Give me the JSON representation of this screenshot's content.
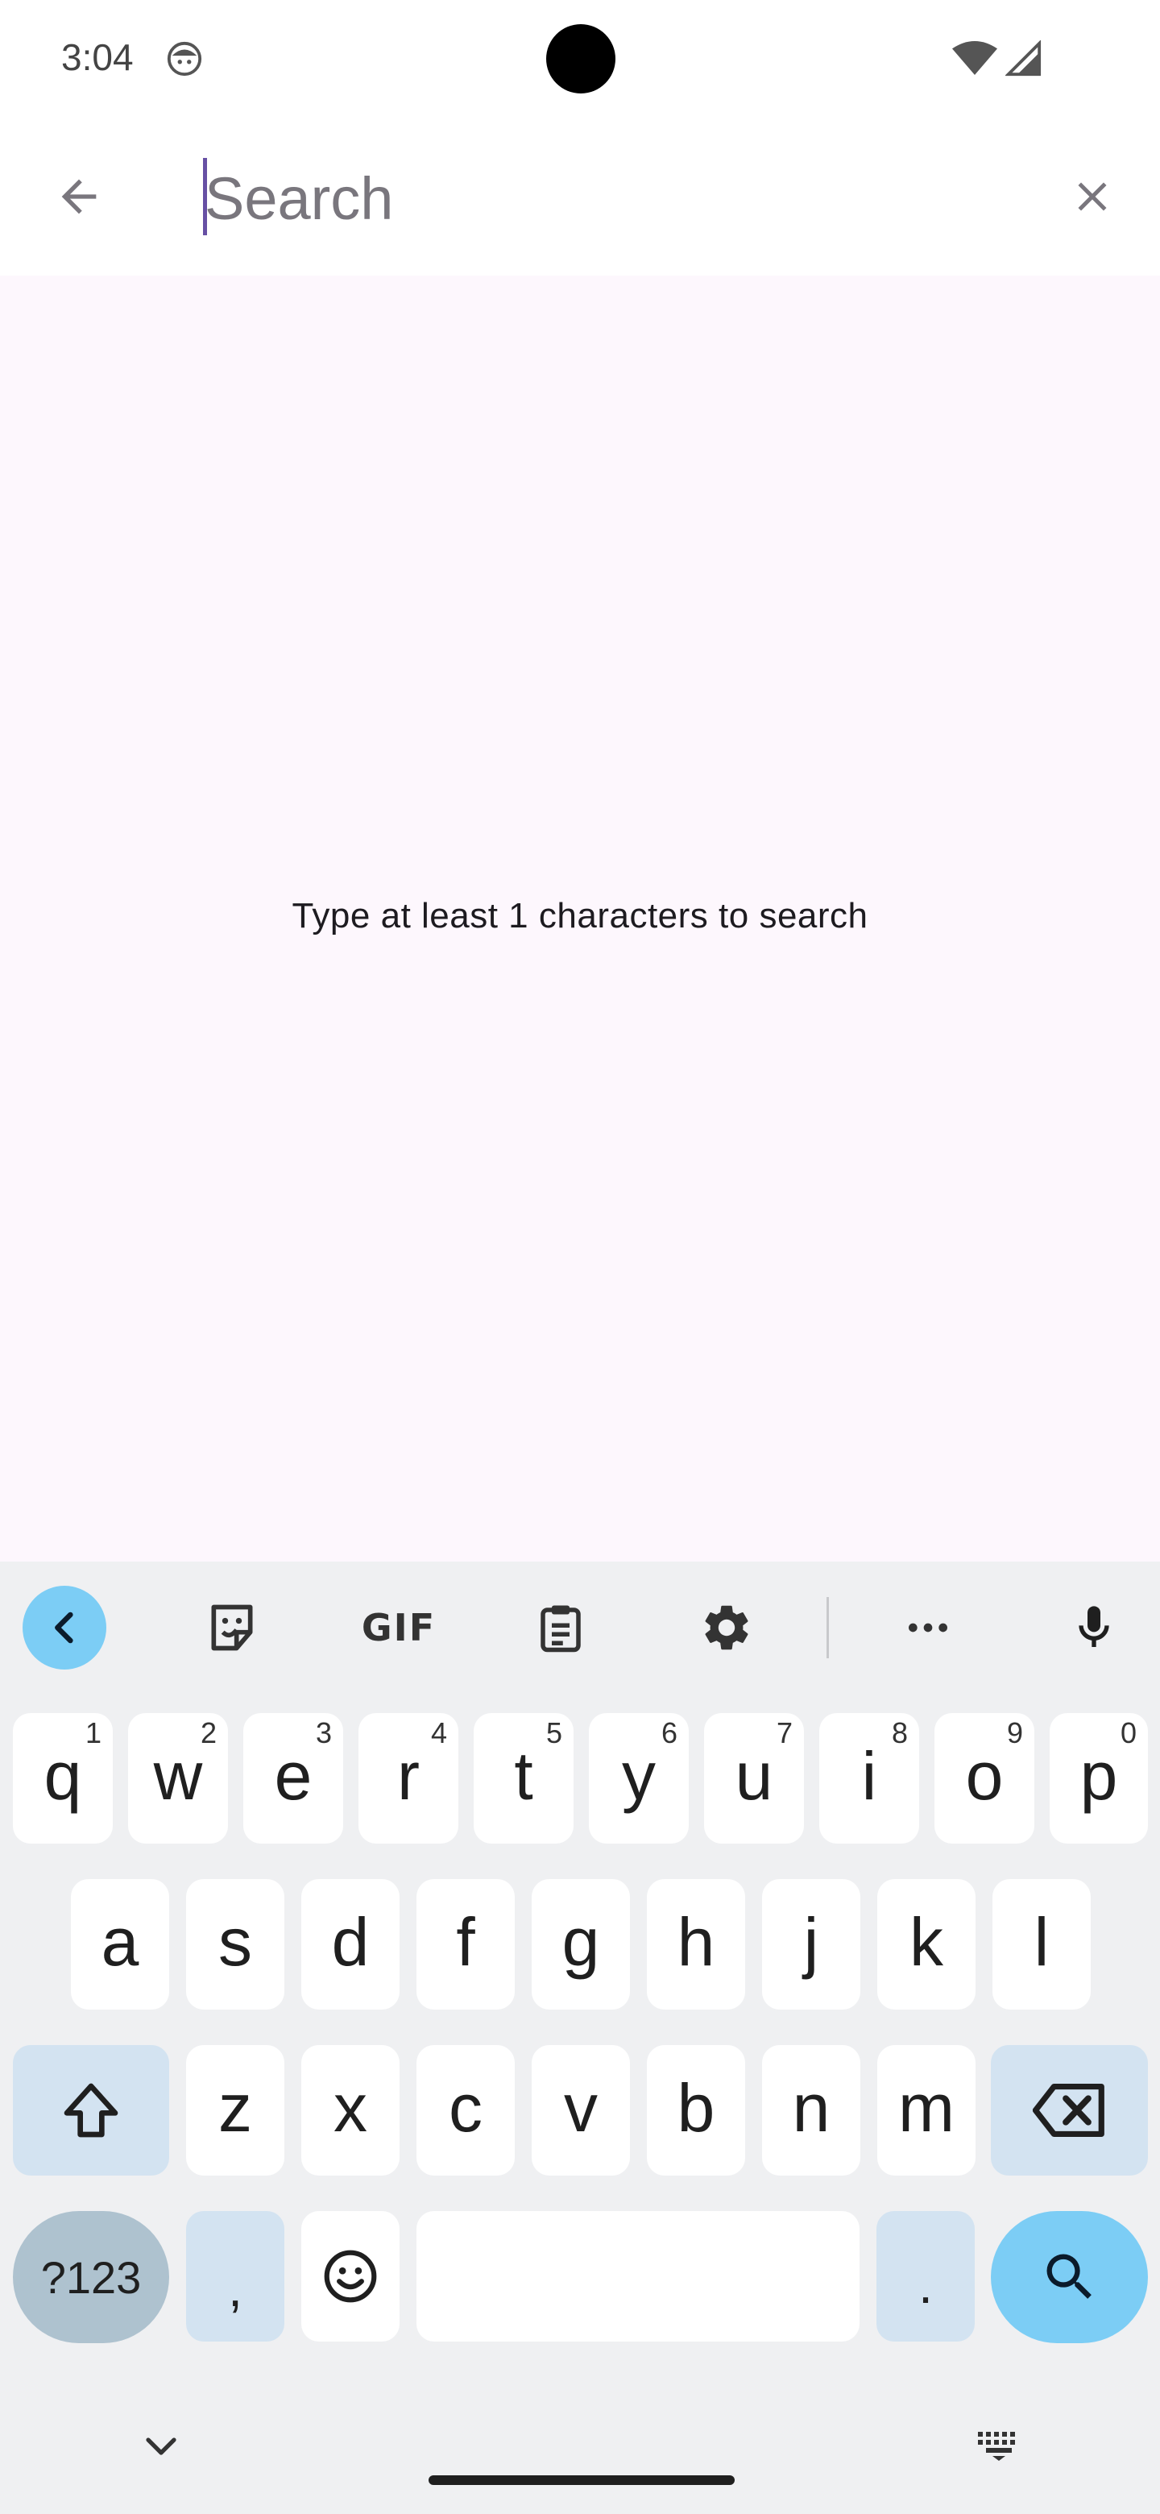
{
  "status_bar": {
    "time": "3:04"
  },
  "search_bar": {
    "placeholder": "Search",
    "value": ""
  },
  "content": {
    "hint": "Type at least 1 characters to search"
  },
  "keyboard": {
    "toolbar": [
      "back",
      "sticker",
      "GIF",
      "clipboard",
      "settings",
      "more",
      "microphone"
    ],
    "gif_label": "GIF",
    "row1": [
      {
        "key": "q",
        "hint": "1"
      },
      {
        "key": "w",
        "hint": "2"
      },
      {
        "key": "e",
        "hint": "3"
      },
      {
        "key": "r",
        "hint": "4"
      },
      {
        "key": "t",
        "hint": "5"
      },
      {
        "key": "y",
        "hint": "6"
      },
      {
        "key": "u",
        "hint": "7"
      },
      {
        "key": "i",
        "hint": "8"
      },
      {
        "key": "o",
        "hint": "9"
      },
      {
        "key": "p",
        "hint": "0"
      }
    ],
    "row2": [
      "a",
      "s",
      "d",
      "f",
      "g",
      "h",
      "j",
      "k",
      "l"
    ],
    "row3": [
      "z",
      "x",
      "c",
      "v",
      "b",
      "n",
      "m"
    ],
    "row4": {
      "symbols": "?123",
      "comma": ",",
      "period": "."
    }
  },
  "colors": {
    "accent": "#6750a4",
    "background": "#fdf7fd",
    "keyboard_bg": "#eff0f2",
    "key_action": "#7ccdf5"
  }
}
